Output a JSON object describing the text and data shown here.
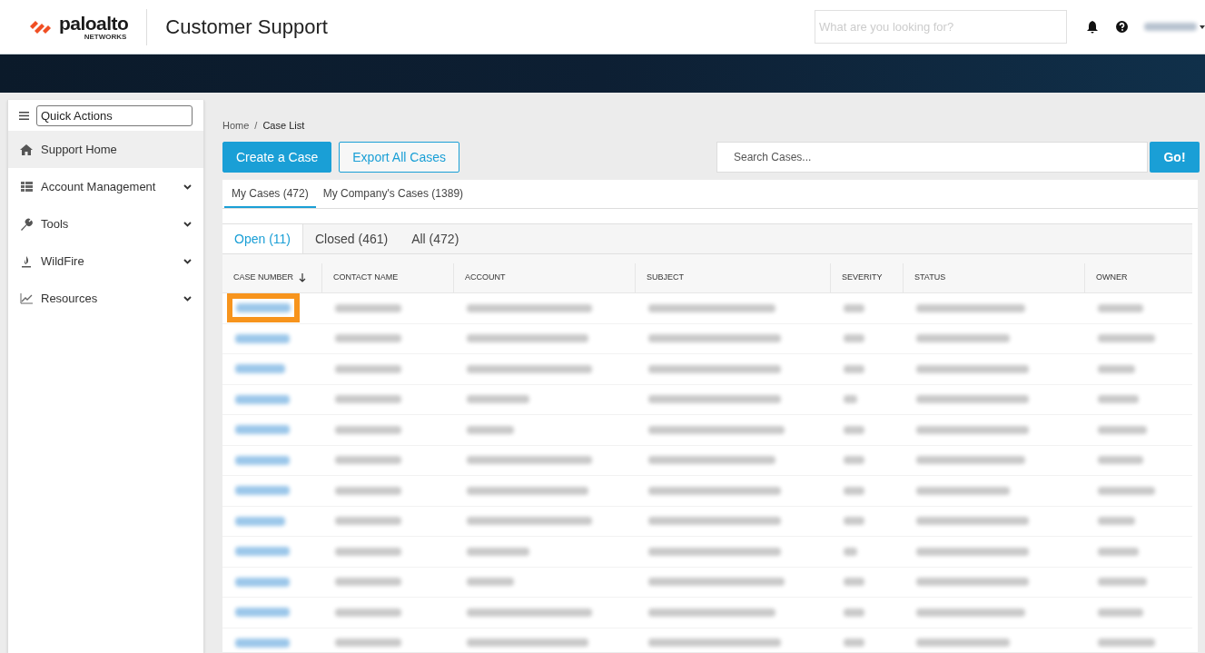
{
  "header": {
    "logo": {
      "wordmark": "paloalto",
      "tagline": "NETWORKS"
    },
    "title": "Customer Support",
    "search": {
      "placeholder": "What are you looking for?"
    }
  },
  "sidebar": {
    "quick_actions": {
      "value": "Quick Actions"
    },
    "items": [
      {
        "label": "Support Home",
        "selected": true,
        "expandable": false
      },
      {
        "label": "Account Management",
        "selected": false,
        "expandable": true
      },
      {
        "label": "Tools",
        "selected": false,
        "expandable": true
      },
      {
        "label": "WildFire",
        "selected": false,
        "expandable": true
      },
      {
        "label": "Resources",
        "selected": false,
        "expandable": true
      }
    ]
  },
  "breadcrumb": {
    "items": [
      "Home",
      "Case List"
    ],
    "separator": "/"
  },
  "actions": [
    {
      "label": "Create a Case",
      "kind": "primary"
    },
    {
      "label": "Export All Cases",
      "kind": "outline"
    }
  ],
  "case_search": {
    "placeholder": "Search Cases...",
    "button": "Go!"
  },
  "scope_tabs": [
    {
      "label": "My Cases (472)",
      "selected": true
    },
    {
      "label": "My Company's Cases (1389)",
      "selected": false
    }
  ],
  "status_tabs": [
    {
      "label": "Open (11)",
      "selected": true
    },
    {
      "label": "Closed (461)",
      "selected": false
    },
    {
      "label": "All (472)",
      "selected": false
    }
  ],
  "table": {
    "columns": [
      {
        "label": "CASE NUMBER",
        "sorted": true
      },
      {
        "label": "CONTACT NAME",
        "sorted": false
      },
      {
        "label": "ACCOUNT",
        "sorted": false
      },
      {
        "label": "SUBJECT",
        "sorted": false
      },
      {
        "label": "SEVERITY",
        "sorted": false
      },
      {
        "label": "STATUS",
        "sorted": false
      },
      {
        "label": "OWNER",
        "sorted": false
      }
    ],
    "rows": [
      {
        "highlighted": true
      },
      {
        "highlighted": false
      },
      {
        "highlighted": false
      },
      {
        "highlighted": false
      },
      {
        "highlighted": false
      },
      {
        "highlighted": false
      },
      {
        "highlighted": false
      },
      {
        "highlighted": false
      },
      {
        "highlighted": false
      },
      {
        "highlighted": false
      },
      {
        "highlighted": false
      },
      {
        "highlighted": false
      }
    ]
  }
}
